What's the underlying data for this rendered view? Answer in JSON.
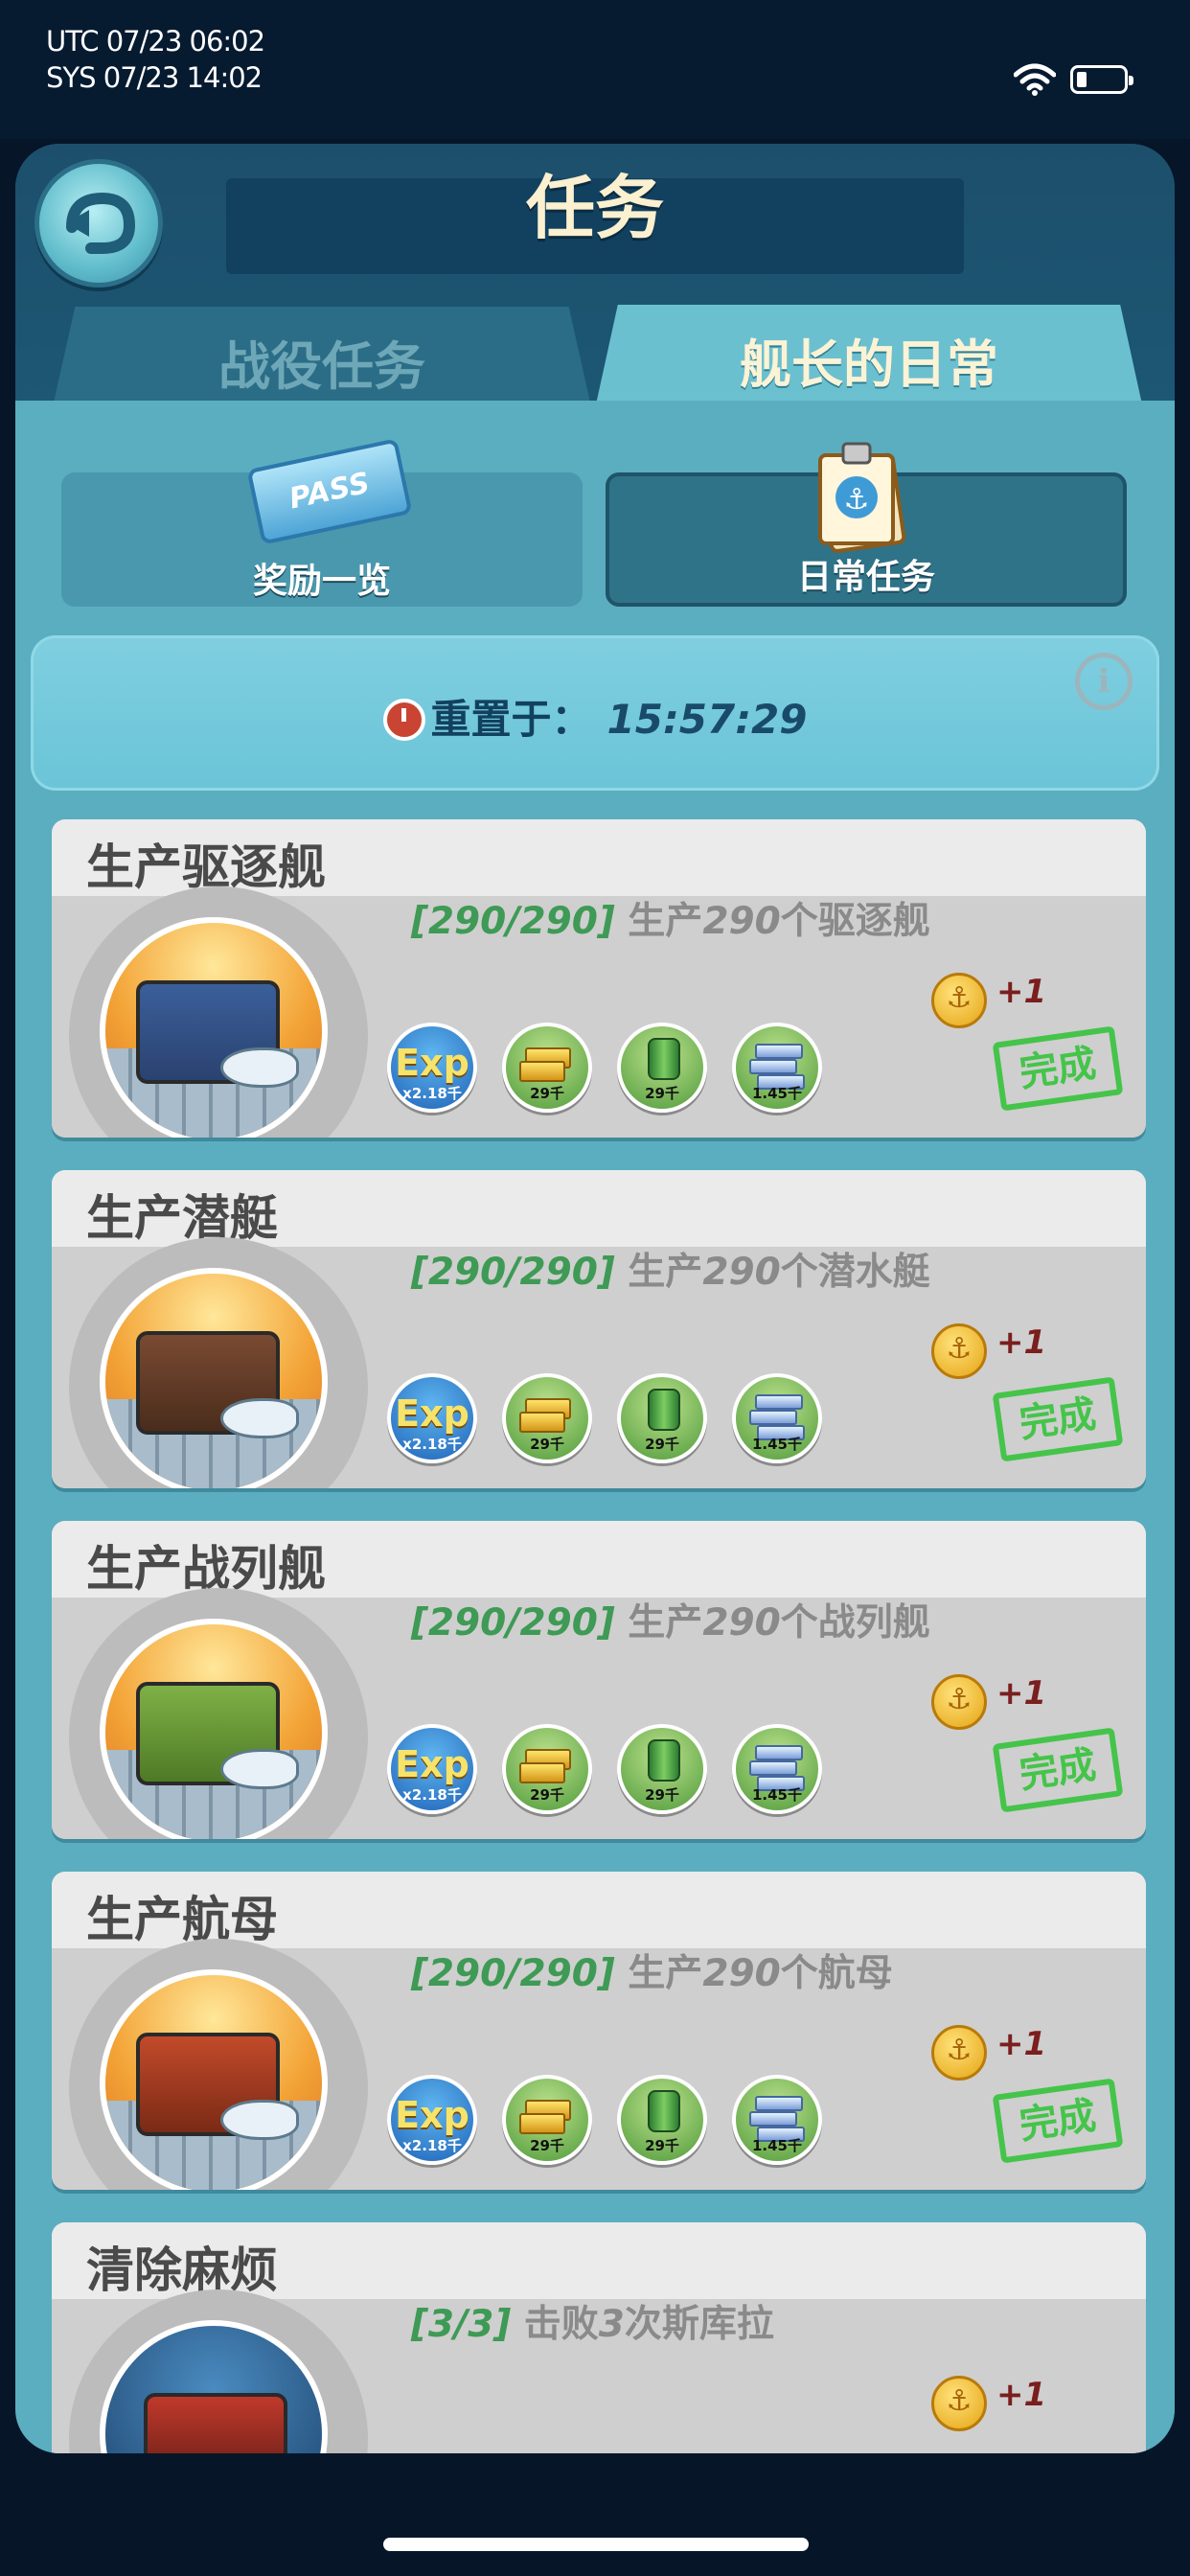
{
  "status_bar": {
    "utc": "UTC 07/23 06:02",
    "sys": "SYS 07/23 14:02"
  },
  "header": {
    "title": "任务"
  },
  "tabs": [
    {
      "label": "战役任务",
      "active": false
    },
    {
      "label": "舰长的日常",
      "active": true
    }
  ],
  "segments": [
    {
      "label": "奖励一览",
      "icon": "pass-ticket-icon",
      "badge": "PASS"
    },
    {
      "label": "日常任务",
      "icon": "clipboard-anchor-icon",
      "selected": true
    }
  ],
  "reset": {
    "label": "重置于：",
    "time": "15:57:29"
  },
  "tasks": [
    {
      "title": "生产驱逐舰",
      "progress": "[290/290]",
      "desc_pre": "生产",
      "desc_num": "290",
      "desc_post": "个驱逐舰",
      "rewards": [
        "x2.18千",
        "29千",
        "29千",
        "1.45千"
      ],
      "coin": "+1",
      "status": "完成"
    },
    {
      "title": "生产潜艇",
      "progress": "[290/290]",
      "desc_pre": "生产",
      "desc_num": "290",
      "desc_post": "个潜水艇",
      "rewards": [
        "x2.18千",
        "29千",
        "29千",
        "1.45千"
      ],
      "coin": "+1",
      "status": "完成"
    },
    {
      "title": "生产战列舰",
      "progress": "[290/290]",
      "desc_pre": "生产",
      "desc_num": "290",
      "desc_post": "个战列舰",
      "rewards": [
        "x2.18千",
        "29千",
        "29千",
        "1.45千"
      ],
      "coin": "+1",
      "status": "完成"
    },
    {
      "title": "生产航母",
      "progress": "[290/290]",
      "desc_pre": "生产",
      "desc_num": "290",
      "desc_post": "个航母",
      "rewards": [
        "x2.18千",
        "29千",
        "29千",
        "1.45千"
      ],
      "coin": "+1",
      "status": "完成"
    },
    {
      "title": "清除麻烦",
      "progress": "[3/3]",
      "desc_pre": "击败",
      "desc_num": "3",
      "desc_post": "次斯库拉",
      "coin": "+1"
    }
  ],
  "reward_icons": [
    "exp-icon",
    "gold-bar-icon",
    "oil-barrel-icon",
    "steel-ingot-icon"
  ],
  "exp_text": "Exp",
  "colors": {
    "panel": "#1e5975",
    "accent_tab": "#6bc0d0",
    "progress_green": "#3e9a55",
    "stamp_green": "#45c44a"
  }
}
